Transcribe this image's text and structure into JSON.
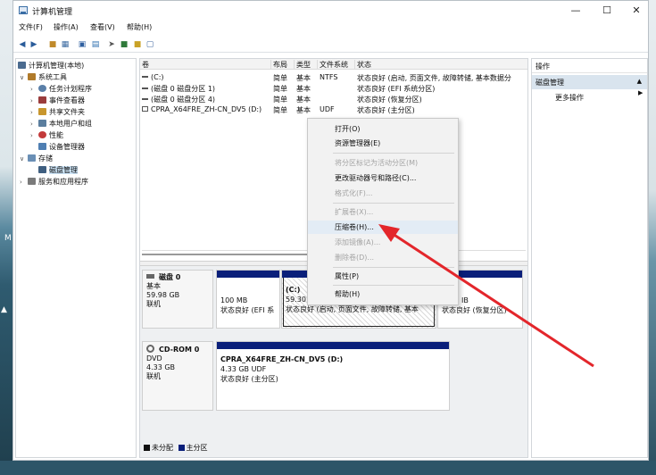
{
  "window": {
    "title": "计算机管理"
  },
  "controls": {
    "minimize": "—",
    "maximize": "☐",
    "close": "✕"
  },
  "menu": [
    "文件(F)",
    "操作(A)",
    "查看(V)",
    "帮助(H)"
  ],
  "toolbar": {
    "icons": [
      "back-arrow-icon",
      "forward-arrow-icon",
      "up-folder-icon",
      "show-tree-icon",
      "properties-icon",
      "help-icon",
      "refresh-icon",
      "disk-list-icon",
      "export-icon",
      "settings-icon"
    ]
  },
  "tree": [
    {
      "label": "计算机管理(本地)",
      "expander": "",
      "icon_color": "#4b6b8f"
    },
    {
      "label": "系统工具",
      "expander": "∨",
      "icon_color": "#b07a2a"
    },
    {
      "label": "任务计划程序",
      "expander": "›",
      "icon_color": "#5a7fa8"
    },
    {
      "label": "事件查看器",
      "expander": "›",
      "icon_color": "#9a3c3c"
    },
    {
      "label": "共享文件夹",
      "expander": "›",
      "icon_color": "#c8962e"
    },
    {
      "label": "本地用户和组",
      "expander": "›",
      "icon_color": "#5b7e9e"
    },
    {
      "label": "性能",
      "expander": "›",
      "icon_color": "#c33a3a"
    },
    {
      "label": "设备管理器",
      "expander": "",
      "icon_color": "#4f7fb3"
    },
    {
      "label": "存储",
      "expander": "∨",
      "icon_color": "#6a8fb5"
    },
    {
      "label": "磁盘管理",
      "expander": "",
      "icon_color": "#3f5f80",
      "selected": true
    },
    {
      "label": "服务和应用程序",
      "expander": "›",
      "icon_color": "#7a7a7a"
    }
  ],
  "volume_table": {
    "headers": [
      "卷",
      "布局",
      "类型",
      "文件系统",
      "状态"
    ],
    "rows": [
      {
        "volume": "(C:)",
        "layout": "简单",
        "type": "基本",
        "fs": "NTFS",
        "status": "状态良好 (启动, 页面文件, 故障转储, 基本数据分"
      },
      {
        "volume": "(磁盘 0 磁盘分区 1)",
        "layout": "简单",
        "type": "基本",
        "fs": "",
        "status": "状态良好 (EFI 系统分区)"
      },
      {
        "volume": "(磁盘 0 磁盘分区 4)",
        "layout": "简单",
        "type": "基本",
        "fs": "",
        "status": "状态良好 (恢复分区)"
      },
      {
        "volume": "CPRA_X64FRE_ZH-CN_DV5 (D:)",
        "layout": "简单",
        "type": "基本",
        "fs": "UDF",
        "status": "状态良好 (主分区)"
      }
    ]
  },
  "disk0": {
    "name": "磁盘 0",
    "type": "基本",
    "size": "59.98 GB",
    "status": "联机",
    "partitions": [
      {
        "size": "100 MB",
        "status": "状态良好 (EFI 系"
      },
      {
        "name": "(C:)",
        "size": "59.30 G",
        "status": "状态良好 (启动, 页面文件, 故障转储, 基本"
      },
      {
        "size": "IB",
        "status": "状态良好 (恢复分区)"
      }
    ]
  },
  "cdrom0": {
    "name": "CD-ROM 0",
    "type": "DVD",
    "size": "4.33 GB",
    "status": "联机",
    "volume": {
      "name": "CPRA_X64FRE_ZH-CN_DV5  (D:)",
      "size": "4.33 GB UDF",
      "status": "状态良好 (主分区)"
    }
  },
  "legend": {
    "unallocated": "未分配",
    "primary": "主分区"
  },
  "actions": {
    "header": "操作",
    "section": "磁盘管理",
    "section_arrow": "▲",
    "more": "更多操作",
    "more_arrow": "▶"
  },
  "context_menu": [
    {
      "label": "打开(O)",
      "enabled": true
    },
    {
      "label": "资源管理器(E)",
      "enabled": true
    },
    {
      "label": "将分区标记为活动分区(M)",
      "enabled": false
    },
    {
      "label": "更改驱动器号和路径(C)...",
      "enabled": true
    },
    {
      "label": "格式化(F)...",
      "enabled": false
    },
    {
      "label": "扩展卷(X)...",
      "enabled": false
    },
    {
      "label": "压缩卷(H)...",
      "enabled": true,
      "highlighted": true
    },
    {
      "label": "添加镜像(A)...",
      "enabled": false
    },
    {
      "label": "删除卷(D)...",
      "enabled": false
    },
    {
      "label": "属性(P)",
      "enabled": true
    },
    {
      "label": "帮助(H)",
      "enabled": true
    }
  ],
  "colors": {
    "primary_partition": "#0a1f7a",
    "unallocated": "#111111",
    "annotation_arrow": "#e3262b",
    "selection": "#cce4f7"
  },
  "desktop": {
    "left_glyph": "M",
    "cursor": "▲"
  }
}
